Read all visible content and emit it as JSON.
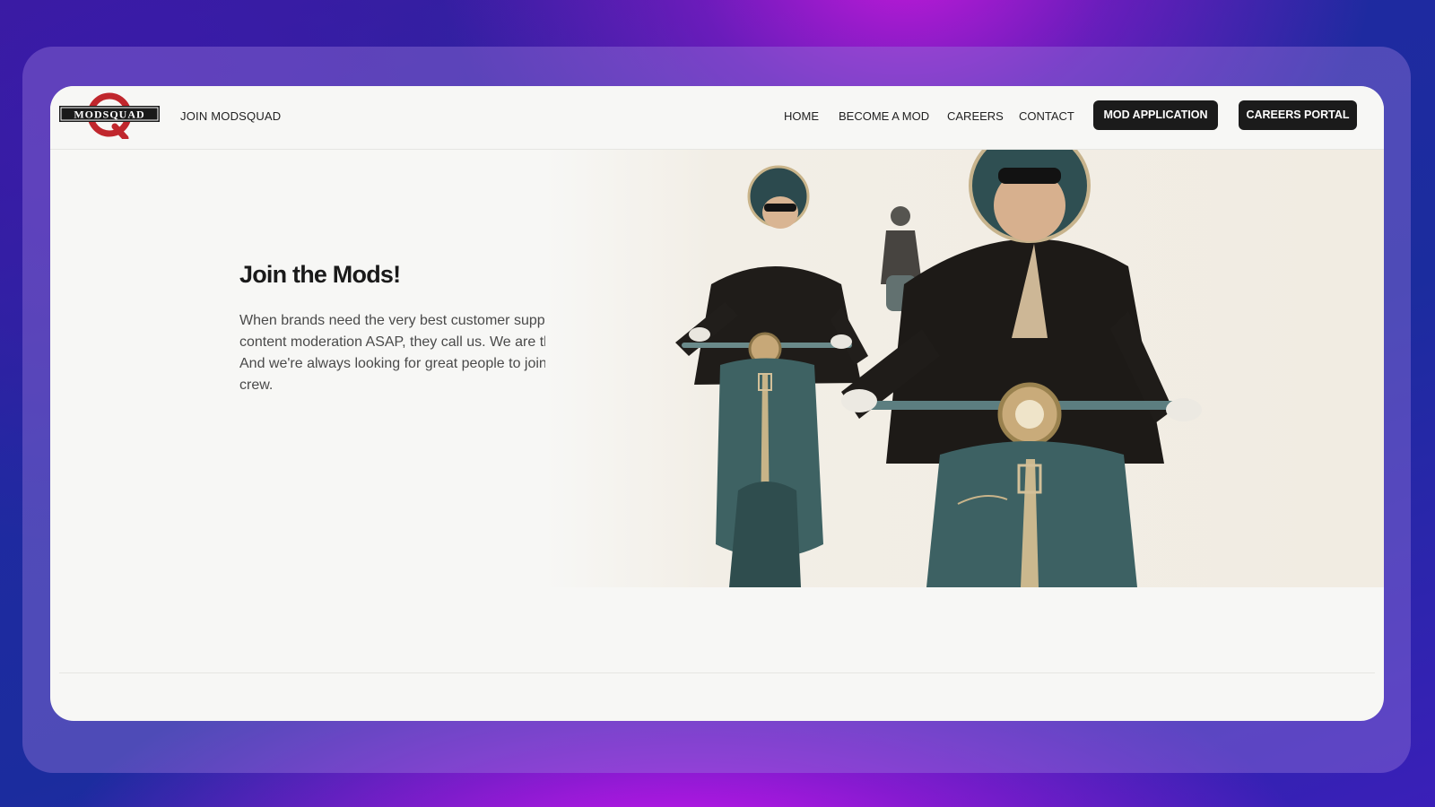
{
  "navbar": {
    "logo_text": "MODSQUAD",
    "brand_link": "JOIN MODSQUAD",
    "links": [
      "HOME",
      "BECOME A MOD",
      "CAREERS",
      "CONTACT"
    ],
    "buttons": [
      "MOD APPLICATION",
      "CAREERS PORTAL"
    ]
  },
  "hero": {
    "title": "Join the Mods!",
    "description": "When brands need the very best customer support and content moderation ASAP, they call us. We are the Mods! And we're always looking for great people to join the crew."
  },
  "colors": {
    "accent": "#c0272d",
    "button_bg": "#1b1b1b",
    "page_bg": "#f7f7f5"
  }
}
